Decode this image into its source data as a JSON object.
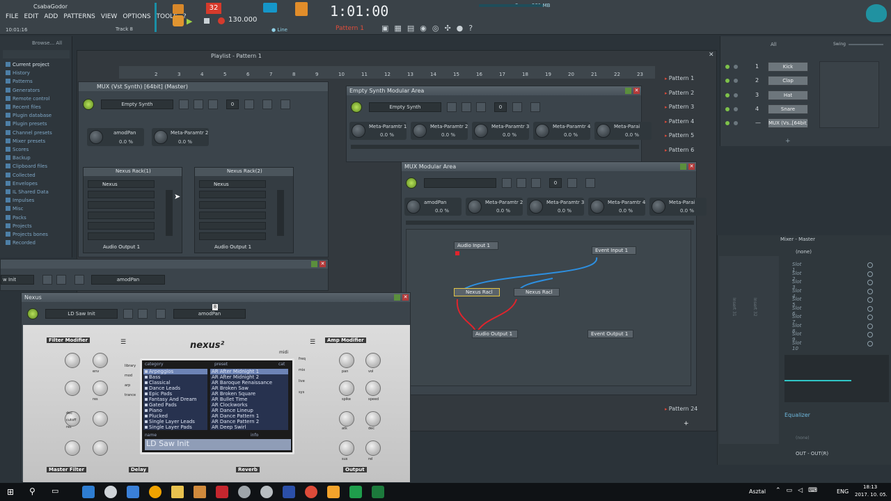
{
  "app": {
    "user": "CsabaGodor",
    "time_small": "10:01:16",
    "track_label": "Track 8",
    "song_time": "1:01:00",
    "tempo": "130.000",
    "pattern": "Pattern 1",
    "line_mode": "Line",
    "cpu": "531 MB",
    "pat_counter": "32",
    "vol_label": "3"
  },
  "menu": [
    "FILE",
    "EDIT",
    "ADD",
    "PATTERNS",
    "VIEW",
    "OPTIONS",
    "TOOLS",
    "?"
  ],
  "browser": {
    "header": "Browse... All",
    "items": [
      "Current project",
      "History",
      "Patterns",
      "Generators",
      "Remote control",
      "Recent files",
      "Plugin database",
      "Plugin presets",
      "Channel presets",
      "Mixer presets",
      "Scores",
      "Backup",
      "Clipboard files",
      "Collected",
      "Envelopes",
      "IL Shared Data",
      "Impulses",
      "Misc",
      "Packs",
      "Projects",
      "Projects bones",
      "Recorded"
    ]
  },
  "playlist": {
    "title": "Playlist - Pattern 1",
    "patterns": [
      "Pattern 1",
      "Pattern 2",
      "Pattern 3",
      "Pattern 4",
      "Pattern 5",
      "Pattern 6",
      "Pattern 24"
    ],
    "ruler": [
      "2",
      "3",
      "4",
      "5",
      "6",
      "7",
      "8",
      "9",
      "10",
      "11",
      "12",
      "13",
      "14",
      "15",
      "16",
      "17",
      "18",
      "19",
      "20",
      "21",
      "22",
      "23"
    ]
  },
  "mux_vst": {
    "title": "MUX (Vst Synth) [64bit] (Master)",
    "preset": "Empty Synth",
    "counter": "0",
    "params": [
      {
        "label": "amodPan",
        "value": "0.0 %"
      },
      {
        "label": "Meta-Paramtr 2",
        "value": "0.0 %"
      }
    ],
    "rack1": {
      "title": "Nexus Rack(1)",
      "slot": "Nexus",
      "output": "Audio Output 1"
    },
    "rack2": {
      "title": "Nexus Rack(2)",
      "slot": "Nexus",
      "output": "Audio Output 1"
    }
  },
  "empty_synth": {
    "title": "Empty Synth Modular Area",
    "preset": "Empty Synth",
    "counter": "0",
    "params": [
      {
        "label": "Meta-Paramtr 1",
        "value": "0.0 %"
      },
      {
        "label": "Meta-Paramtr 2",
        "value": "0.0 %"
      },
      {
        "label": "Meta-Paramtr 3",
        "value": "0.0 %"
      },
      {
        "label": "Meta-Paramtr 4",
        "value": "0.0 %"
      },
      {
        "label": "Meta-Parai",
        "value": "0.0 %"
      }
    ]
  },
  "mux_mod": {
    "title": "MUX Modular Area",
    "counter": "0",
    "params": [
      {
        "label": "amodPan",
        "value": "0.0 %"
      },
      {
        "label": "Meta-Paramtr 2",
        "value": "0.0 %"
      },
      {
        "label": "Meta-Paramtr 3",
        "value": "0.0 %"
      },
      {
        "label": "Meta-Paramtr 4",
        "value": "0.0 %"
      },
      {
        "label": "Meta-Parai",
        "value": "0.0 %"
      }
    ],
    "nodes": {
      "audio_in": "Audio Input 1",
      "event_in": "Event Input 1",
      "rack_a": "Nexus Racl",
      "rack_b": "Nexus Racl",
      "audio_out": "Audio Output 1",
      "event_out": "Event Output 1"
    }
  },
  "side_strip": {
    "preset": "w Init",
    "param": "amodPan"
  },
  "nexus": {
    "title": "Nexus",
    "preset": "LD Saw Init",
    "param": "amodPan",
    "badge": "8",
    "logo": "nexus²",
    "midi": "midi",
    "filter_title": "Filter Modifier",
    "amp_title": "Amp Modifier",
    "master_filter": "Master Filter",
    "delay": "Delay",
    "reverb": "Reverb",
    "output": "Output",
    "tabs_left": [
      "library",
      "mod",
      "arp",
      "trance"
    ],
    "tabs_right": [
      "freq",
      "mix",
      "live",
      "sys"
    ],
    "cat_header": "category",
    "preset_header": "preset",
    "cat_btn": "cat",
    "categories": [
      "Arpeggios",
      "Bass",
      "Classical",
      "Dance Leads",
      "Epic Pads",
      "Fantasy And Dream",
      "Gated Pads",
      "Piano",
      "Plucked",
      "Single Layer Leads",
      "Single Layer Pads"
    ],
    "presets": [
      "AR After Midnight 1",
      "AR After Midnight 2",
      "AR Baroque Renaissance",
      "AR Broken Saw",
      "AR Broken Square",
      "AR Bullet Time",
      "AR Clockworks",
      "AR Dance Lineup",
      "AR Dance Pattern 1",
      "AR Dance Pattern 2",
      "AR Deep Swirl"
    ],
    "name_label": "name",
    "info_label": "info",
    "display_name": "LD Saw Init",
    "knobs_left": [
      "env",
      "res",
      "dec",
      "cutoff",
      "res"
    ],
    "knobs_left2": [
      "",
      "atk",
      "dec",
      "sus",
      "rel"
    ],
    "knobs_right": [
      "pan",
      "vol",
      "spike",
      "speed"
    ],
    "knobs_right2": [
      "atk",
      "dec",
      "sus",
      "rel"
    ]
  },
  "channel_rack": {
    "filter": "All",
    "swing": "Swing",
    "channels": [
      {
        "num": "1",
        "name": "Kick"
      },
      {
        "num": "2",
        "name": "Clap"
      },
      {
        "num": "3",
        "name": "Hat"
      },
      {
        "num": "4",
        "name": "Snare"
      },
      {
        "num": "—",
        "name": "MUX (Vs..[64bit]"
      }
    ]
  },
  "mixer": {
    "title": "Mixer - Master",
    "preset": "(none)",
    "slots": [
      "Slot 1",
      "Slot 2",
      "Slot 3",
      "Slot 4",
      "Slot 5",
      "Slot 6",
      "Slot 7",
      "Slot 8",
      "Slot 9",
      "Slot 10"
    ],
    "insert_a": "Insert 31",
    "insert_b": "Insert 32",
    "equalizer": "Equalizer",
    "eq_preset": "(none)",
    "route": "OUT - OUT(R)"
  },
  "taskbar": {
    "desktop": "Asztal",
    "lang": "ENG",
    "time": "18:13",
    "date": "2017. 10. 05."
  }
}
